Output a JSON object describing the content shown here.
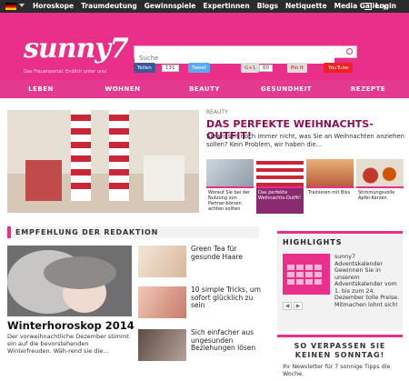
{
  "topnav": {
    "items": [
      "Horoskope",
      "Traumdeutung",
      "Gewinnspiele",
      "Expertinnen",
      "Blogs",
      "Netiquette",
      "Media Gallery"
    ],
    "login": "Login"
  },
  "header": {
    "logo": "sunny7",
    "tagline": "Das Frauenportal. Endlich unter uns!",
    "search_placeholder": "Suche"
  },
  "social": {
    "facebook": "Teilen",
    "facebook_count": "131",
    "twitter": "Tweet",
    "gplus": "G+1",
    "gplus_count": "60",
    "pin": "Pin it",
    "youtube": "YouTube"
  },
  "nav": {
    "items": [
      "LEBEN",
      "WOHNEN",
      "BEAUTY",
      "GESUNDHEIT",
      "REZEPTE"
    ]
  },
  "hero": {
    "category": "BEAUTY",
    "title": "DAS PERFEKTE WEIHNACHTS-OUTFIT!",
    "text": "Sie wissen noch immer nicht, was Sie an Weihnachten anziehen sollen? Kein Problem, wir haben die...",
    "thumbs": [
      {
        "caption": "Worauf Sie bei der Nutzung von Partner-börsen achten sollten"
      },
      {
        "caption": "Das perfekte Weihnachts-Outfit!"
      },
      {
        "caption": "Trainieren mit Biss"
      },
      {
        "caption": "Stimmungsvolle Apfel-Kerzen"
      }
    ]
  },
  "recommend": {
    "title": "EMPFEHLUNG DER REDAKTION",
    "main_title": "Winterhoroskop 2014",
    "main_text": "Der vorweihnachtliche Dezember stimmt ein auf die bevorstehenden Winterfreuden. Wäh-rend sie die...",
    "items": [
      "Green Tea für gesunde Haare",
      "10 simple Tricks, um sofort glücklich zu sein",
      "Sich einfacher aus ungesunden Beziehungen lösen"
    ]
  },
  "highlights": {
    "title": "HIGHLIGHTS",
    "text": "sunny7 Adventskalender Gewinnen Sie in unserem Adventskalender vom 1. bis zum 24. Dezember tolle Preise. Mitmachen lohnt sich!",
    "prev": "◀",
    "next": "▶"
  },
  "newsletter": {
    "title": "SO VERPASSEN SIE KEINEN SONNTAG!",
    "text": "Ihr Newsletter für 7 sonnige Tipps die Woche."
  },
  "colors": {
    "brand": "#e8308a",
    "dark": "#2b2b2b",
    "accent": "#8a0f58"
  }
}
